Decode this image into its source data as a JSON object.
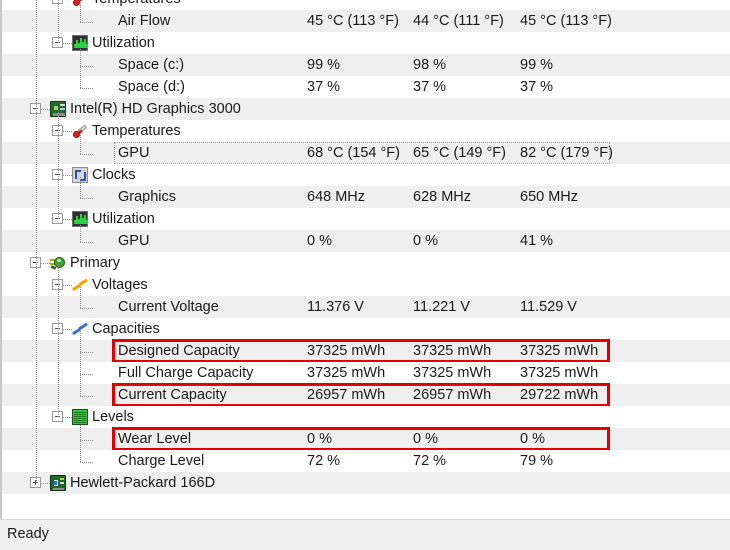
{
  "app": {
    "status_text": "Ready"
  },
  "columns": {
    "count": 3,
    "headers_visible": false
  },
  "tree": {
    "rows": [
      {
        "id": "temperatures-1",
        "label": "Temperatures",
        "kind": "group",
        "icon": "thermometer-icon",
        "depth": 1,
        "expander": "minus",
        "stripe": false,
        "values": [
          "",
          "",
          ""
        ]
      },
      {
        "id": "air-flow",
        "label": "Air Flow",
        "kind": "sensor",
        "icon": "none",
        "depth": 2,
        "expander": "none",
        "stripe": true,
        "values": [
          "45 °C  (113 °F)",
          "44 °C  (111 °F)",
          "45 °C  (113 °F)"
        ]
      },
      {
        "id": "utilization-1",
        "label": "Utilization",
        "kind": "group",
        "icon": "chart-icon",
        "depth": 1,
        "expander": "minus",
        "stripe": false,
        "values": [
          "",
          "",
          ""
        ]
      },
      {
        "id": "space-c",
        "label": "Space (c:)",
        "kind": "sensor",
        "icon": "none",
        "depth": 2,
        "expander": "none",
        "stripe": true,
        "values": [
          "99 %",
          "98 %",
          "99 %"
        ]
      },
      {
        "id": "space-d",
        "label": "Space (d:)",
        "kind": "sensor",
        "icon": "none",
        "depth": 2,
        "expander": "none",
        "stripe": false,
        "values": [
          "37 %",
          "37 %",
          "37 %"
        ]
      },
      {
        "id": "intel-hd-graphics-3000",
        "label": "Intel(R) HD Graphics 3000",
        "kind": "device",
        "icon": "graphics-card-icon",
        "depth": 0,
        "expander": "minus",
        "stripe": true,
        "values": [
          "",
          "",
          ""
        ]
      },
      {
        "id": "temperatures-2",
        "label": "Temperatures",
        "kind": "group",
        "icon": "thermometer-icon",
        "depth": 1,
        "expander": "minus",
        "stripe": false,
        "values": [
          "",
          "",
          ""
        ]
      },
      {
        "id": "gpu-temp",
        "label": "GPU",
        "kind": "sensor",
        "icon": "none",
        "depth": 2,
        "expander": "none",
        "stripe": true,
        "focused": true,
        "values": [
          "68 °C  (154 °F)",
          "65 °C  (149 °F)",
          "82 °C  (179 °F)"
        ]
      },
      {
        "id": "clocks",
        "label": "Clocks",
        "kind": "group",
        "icon": "clock-wave-icon",
        "depth": 1,
        "expander": "minus",
        "stripe": false,
        "values": [
          "",
          "",
          ""
        ]
      },
      {
        "id": "graphics-clock",
        "label": "Graphics",
        "kind": "sensor",
        "icon": "none",
        "depth": 2,
        "expander": "none",
        "stripe": true,
        "values": [
          "648 MHz",
          "628 MHz",
          "650 MHz"
        ]
      },
      {
        "id": "utilization-2",
        "label": "Utilization",
        "kind": "group",
        "icon": "chart-icon",
        "depth": 1,
        "expander": "minus",
        "stripe": false,
        "values": [
          "",
          "",
          ""
        ]
      },
      {
        "id": "gpu-utilization",
        "label": "GPU",
        "kind": "sensor",
        "icon": "none",
        "depth": 2,
        "expander": "none",
        "stripe": true,
        "values": [
          "0 %",
          "0 %",
          "41 %"
        ]
      },
      {
        "id": "primary",
        "label": "Primary",
        "kind": "device",
        "icon": "battery-plug-icon",
        "depth": 0,
        "expander": "minus",
        "stripe": false,
        "values": [
          "",
          "",
          ""
        ]
      },
      {
        "id": "voltages",
        "label": "Voltages",
        "kind": "group",
        "icon": "bolt-yellow-icon",
        "depth": 1,
        "expander": "minus",
        "stripe": false,
        "values": [
          "",
          "",
          ""
        ]
      },
      {
        "id": "current-voltage",
        "label": "Current Voltage",
        "kind": "sensor",
        "icon": "none",
        "depth": 2,
        "expander": "none",
        "stripe": true,
        "values": [
          "11.376 V",
          "11.221 V",
          "11.529 V"
        ]
      },
      {
        "id": "capacities",
        "label": "Capacities",
        "kind": "group",
        "icon": "bolt-blue-icon",
        "depth": 1,
        "expander": "minus",
        "stripe": false,
        "values": [
          "",
          "",
          ""
        ]
      },
      {
        "id": "designed-capacity",
        "label": "Designed Capacity",
        "kind": "sensor",
        "icon": "none",
        "depth": 2,
        "expander": "none",
        "stripe": true,
        "highlighted": true,
        "values": [
          "37325 mWh",
          "37325 mWh",
          "37325 mWh"
        ]
      },
      {
        "id": "full-charge-capacity",
        "label": "Full Charge Capacity",
        "kind": "sensor",
        "icon": "none",
        "depth": 2,
        "expander": "none",
        "stripe": false,
        "values": [
          "37325 mWh",
          "37325 mWh",
          "37325 mWh"
        ]
      },
      {
        "id": "current-capacity",
        "label": "Current Capacity",
        "kind": "sensor",
        "icon": "none",
        "depth": 2,
        "expander": "none",
        "stripe": true,
        "highlighted": true,
        "values": [
          "26957 mWh",
          "26957 mWh",
          "29722 mWh"
        ]
      },
      {
        "id": "levels",
        "label": "Levels",
        "kind": "group",
        "icon": "levels-icon",
        "depth": 1,
        "expander": "minus",
        "stripe": false,
        "values": [
          "",
          "",
          ""
        ]
      },
      {
        "id": "wear-level",
        "label": "Wear Level",
        "kind": "sensor",
        "icon": "none",
        "depth": 2,
        "expander": "none",
        "stripe": true,
        "highlighted": true,
        "values": [
          "0 %",
          "0 %",
          "0 %"
        ]
      },
      {
        "id": "charge-level",
        "label": "Charge Level",
        "kind": "sensor",
        "icon": "none",
        "depth": 2,
        "expander": "none",
        "stripe": false,
        "values": [
          "72 %",
          "72 %",
          "79 %"
        ]
      },
      {
        "id": "hewlett-packard-166d",
        "label": "Hewlett-Packard 166D",
        "kind": "device",
        "icon": "board-icon",
        "depth": 0,
        "expander": "plus",
        "stripe": true,
        "values": [
          "",
          "",
          ""
        ]
      }
    ]
  },
  "annotations": {
    "highlight_color": "#e00000",
    "highlight_rows": [
      "designed-capacity",
      "current-capacity",
      "wear-level"
    ]
  }
}
